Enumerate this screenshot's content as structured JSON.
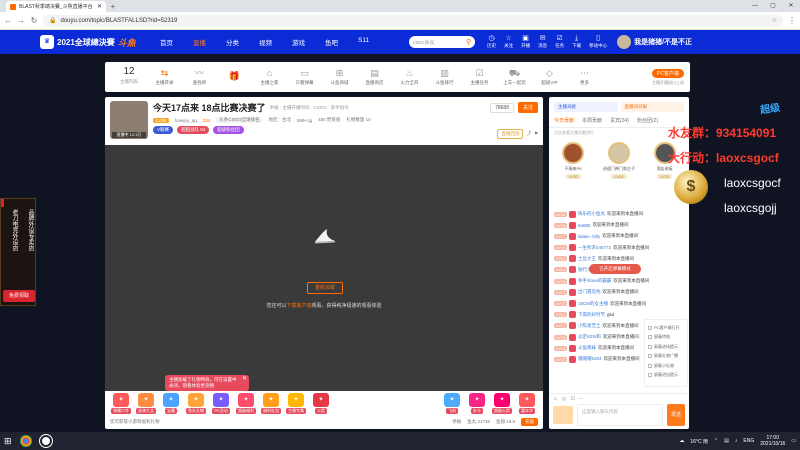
{
  "browser": {
    "tab_title": "BLAST秋季總決賽_斗魚直播平台",
    "url": "douyu.com/topic/BLASTFALLSD?rid=52319",
    "window_controls": [
      "—",
      "▢",
      "✕"
    ]
  },
  "site": {
    "logo_text": "2021全球總決賽",
    "brand": "斗魚",
    "nav": [
      "首页",
      "直播",
      "分类",
      "视频",
      "游戏",
      "鱼吧",
      "S11"
    ],
    "search_placeholder": "csisc会议",
    "header_icons": [
      {
        "icon": "clock-icon",
        "label": "历史"
      },
      {
        "icon": "star-icon",
        "label": "关注"
      },
      {
        "icon": "broadcast-icon",
        "label": "开播"
      },
      {
        "icon": "mail-icon",
        "label": "消息"
      },
      {
        "icon": "task-icon",
        "label": "任务"
      },
      {
        "icon": "download-icon",
        "label": "下载"
      },
      {
        "icon": "app-icon",
        "label": "移动中心"
      }
    ],
    "username": "我是猪猪/不是不正"
  },
  "categories": {
    "count": "12",
    "count_label": "主播列表",
    "items": [
      {
        "icon": "switch-icon",
        "label": "主播开关"
      },
      {
        "icon": "wave-icon",
        "label": "查找师"
      },
      {
        "icon": "gift-icon",
        "label": ""
      },
      {
        "icon": "home-icon",
        "label": "主播之家"
      },
      {
        "icon": "chat-icon",
        "label": "只看弹幕"
      },
      {
        "icon": "cart-icon",
        "label": "斗鱼商城"
      },
      {
        "icon": "ad-icon",
        "label": "直播商店"
      },
      {
        "icon": "fire-icon",
        "label": "火力全开"
      },
      {
        "icon": "chart-icon",
        "label": "斗鱼排行"
      },
      {
        "icon": "check-icon",
        "label": "主播任务"
      },
      {
        "icon": "car-icon",
        "label": "上车一起玩"
      },
      {
        "icon": "diamond-icon",
        "label": "超级VIP"
      },
      {
        "icon": "more-icon",
        "label": "更多"
      }
    ],
    "pc_button": "PC客户端",
    "pc_sub": "主播开播接口上线"
  },
  "left_ad": {
    "col1": "老刀电竞外设店",
    "col2": "品牌外设专卖店",
    "bottom": "免费领取"
  },
  "room": {
    "avatar_tag": "直播中 12.3万",
    "title": "今天17点来 18点比赛决赛了",
    "title_meta": "举报 · 主播开播时间 · CSGO · 新手指导",
    "level": "LV36",
    "streamer": "lovejoy_qq",
    "heat": "334",
    "rank_badge": "头条CSGO全球排名",
    "meta": [
      "地区：台北",
      "999+1g",
      "480 赞赏值",
      "礼物数量 10"
    ],
    "pills": [
      "V联赛",
      "超超战队 84",
      "超级粉丝团"
    ],
    "viewers": "78688",
    "follow": "关注",
    "right_link": "直播回放",
    "right_icons": [
      "分享",
      "举报"
    ]
  },
  "video": {
    "retry": "重新加载",
    "msg_prefix": "您还可以",
    "msg_highlight": "下载客户端",
    "msg_suffix": "观看，获得纯净极速的观看体验",
    "popup_line1": "主播加载了礼物特效，可在设置中",
    "popup_line2": "关闭，观看体验更流畅",
    "popup_close": "✕"
  },
  "gifts": [
    {
      "label": "弹幕口令",
      "color": "#ff5a5a"
    },
    {
      "label": "坐骑大全",
      "color": "#ff8c42"
    },
    {
      "label": "宝藏",
      "color": "#4aa3ff"
    },
    {
      "label": "鱼丸礼物",
      "color": "#ffa33a"
    },
    {
      "label": "PK活动",
      "color": "#7b5cff"
    },
    {
      "label": "超级福利",
      "color": "#ff4d6d"
    },
    {
      "label": "福利礼包",
      "color": "#ff9f1c"
    },
    {
      "label": "主播专属",
      "color": "#ffb703"
    },
    {
      "label": "火箭",
      "color": "#e63946"
    },
    {
      "label": "飞机",
      "color": "#4dabf7"
    },
    {
      "label": "办卡",
      "color": "#f72585"
    },
    {
      "label": "超级火箭",
      "color": "#ff006e"
    },
    {
      "label": "嘉年华",
      "color": "#ff595e"
    }
  ],
  "player_footer": {
    "left": "您可获取小游戏福利礼物",
    "items": [
      "举报",
      "鱼丸 21736",
      "鱼翅 16.8"
    ],
    "charge": "充值"
  },
  "chat": {
    "top_left": "主播贡献",
    "top_right": "直播间日报",
    "tabs": [
      "今日贡献",
      "本周贡献",
      "贵宾(34)",
      "粉丝团(2)"
    ],
    "note": "点击查看主播贡献排行",
    "fans": [
      {
        "name": "不服来PK",
        "level": "LV30"
      },
      {
        "name": "逍遥门神门和主子",
        "level": "LV28"
      },
      {
        "name": "酒店老板",
        "level": "LV26"
      }
    ],
    "messages": [
      {
        "lv": "LV16",
        "name": "快乐的小鱼丸",
        "text": "欢迎来到本直播间"
      },
      {
        "lv": "LV18",
        "name": "6a885",
        "text": "欢迎来到本直播间"
      },
      {
        "lv": "LV17",
        "name": "lalala~ billy",
        "text": "欢迎来到本直播间"
      },
      {
        "lv": "LV15",
        "name": "一生所求446772",
        "text": "欢迎来到本直播间"
      },
      {
        "lv": "LV19",
        "name": "土豆大王",
        "text": "欢迎来到本直播间"
      },
      {
        "lv": "LV14",
        "name": "独行大侠",
        "text": "欢迎来到本直播间"
      },
      {
        "lv": "LV16",
        "name": "杀手4love的霸霸",
        "text": "欢迎来到本直播间"
      },
      {
        "lv": "LV13",
        "name": "出门遇见他",
        "text": "欢迎来到本直播间"
      },
      {
        "lv": "LV12",
        "name": "18CM的女主播",
        "text": "欢迎来到本直播间"
      },
      {
        "lv": "LV10",
        "name": "下雨的好时节",
        "text": "gkd"
      },
      {
        "lv": "LV17",
        "name": "小陈发芝士",
        "text": "欢迎来到本直播间"
      },
      {
        "lv": "LV15",
        "name": "淡定KEN和",
        "text": "欢迎来到本直播间"
      },
      {
        "lv": "LV16",
        "name": "斗鱼萌妹",
        "text": "欢迎来到本直播间"
      },
      {
        "lv": "LV12",
        "name": "帽帽帽5284",
        "text": "欢迎来到本直播间"
      }
    ],
    "toast": "已开启弹幕模式",
    "menu": [
      "PC客户端打开",
      "屏蔽特效",
      "屏蔽进场提示",
      "屏蔽礼物广播",
      "屏蔽小礼物",
      "屏蔽进出提示"
    ],
    "input_tools": [
      "表情",
      "鱼丸",
      "礼物",
      "更多"
    ],
    "input_placeholder": "这里输入聊天内容",
    "send": "发送"
  },
  "overlay": {
    "line1": "水友群：934154091",
    "line2": "大行动：laoxcsgocf",
    "line3": "laoxcsgocf",
    "line4": "laoxcsgojj",
    "mascot": "超级"
  },
  "taskbar": {
    "temp": "16°C 雨",
    "lang": "ENG",
    "time": "17:00",
    "date": "2021/10/16"
  }
}
